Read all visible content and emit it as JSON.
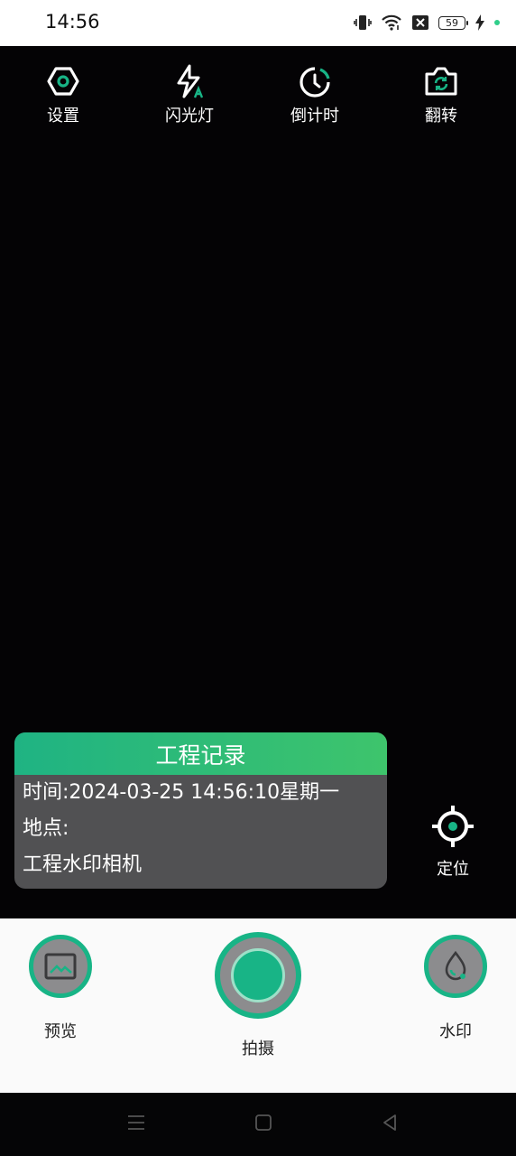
{
  "status_bar": {
    "time": "14:56",
    "battery_level": "59",
    "icons": [
      "vibrate-icon",
      "wifi-icon",
      "sim-off-icon",
      "battery-icon",
      "charging-icon",
      "green-dot-indicator"
    ]
  },
  "toolbar": {
    "settings_label": "设置",
    "flash_label": "闪光灯",
    "timer_label": "倒计时",
    "flip_label": "翻转"
  },
  "watermark": {
    "title": "工程记录",
    "time_line": "时间:2024-03-25 14:56:10星期一",
    "location_line": "地点:",
    "app_line": "工程水印相机"
  },
  "locate": {
    "label": "定位"
  },
  "bottom_bar": {
    "preview_label": "预览",
    "shoot_label": "拍摄",
    "watermark_label": "水印"
  },
  "colors": {
    "accent": "#18b486",
    "accent_light": "#3ec46c",
    "camera_bg": "#040305",
    "card_bg": "#58585a"
  }
}
